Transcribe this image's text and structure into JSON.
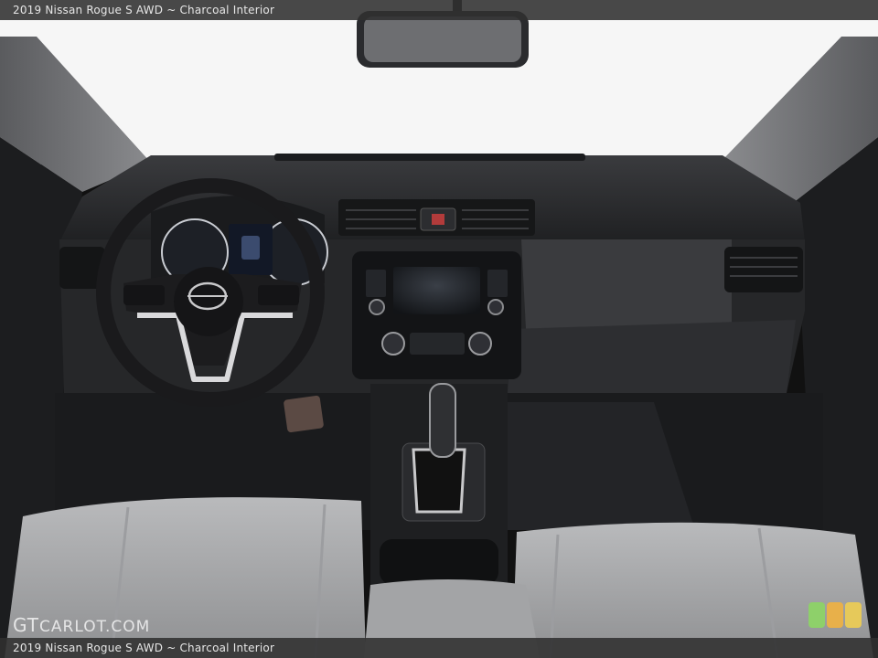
{
  "caption": {
    "top": "2019 Nissan Rogue S AWD ~ Charcoal Interior",
    "bottom": "2019 Nissan Rogue S AWD ~ Charcoal Interior"
  },
  "watermark": {
    "brand_prefix": "GT",
    "brand_rest": "CARLOT.COM"
  },
  "badge": {
    "colors": [
      "#8ed06a",
      "#e8b04a",
      "#e6c95a"
    ]
  },
  "colors": {
    "windshield": "#f6f6f6",
    "dashboard": "#2b2c2f",
    "seat": "#a9aaac"
  }
}
